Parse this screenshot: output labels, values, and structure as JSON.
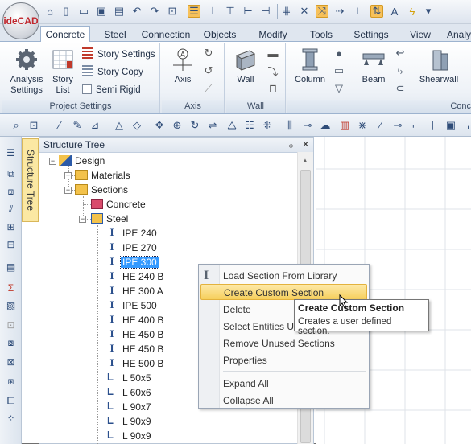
{
  "app": {
    "logo_text": "ideCAD"
  },
  "ribbon_tabs": [
    "Concrete",
    "Steel",
    "Connection",
    "Objects",
    "Modify",
    "Tools",
    "Settings",
    "View",
    "Analys"
  ],
  "project_settings": {
    "analysis_settings": "Analysis Settings",
    "story_list": "Story List",
    "story_settings": "Story Settings",
    "story_copy": "Story Copy",
    "semi_rigid": "Semi Rigid",
    "label": "Project Settings"
  },
  "axis_group": {
    "button": "Axis",
    "label": "Axis"
  },
  "wall_group": {
    "button": "Wall",
    "label": "Wall"
  },
  "conc_group": {
    "column": "Column",
    "beam": "Beam",
    "shearwall": "Shearwall",
    "label": "Conc"
  },
  "side_tab": "Structure Tree",
  "panel": {
    "title": "Structure Tree",
    "pin": "ᵩ",
    "close": "✕",
    "nodes": {
      "design": "Design",
      "materials": "Materials",
      "sections": "Sections",
      "concrete": "Concrete",
      "steel": "Steel",
      "items": [
        "IPE 240",
        "IPE 270",
        "IPE 300",
        "HE 240 B",
        "HE 300 A",
        "IPE 500",
        "HE 400 B",
        "HE 450 B",
        "HE 450 B",
        "HE 500 B",
        "L 50x5",
        "L 60x6",
        "L 90x7",
        "L 90x9",
        "L 90x9"
      ]
    }
  },
  "context_menu": {
    "load_section": "Load Section From Library",
    "create_custom": "Create Custom Section",
    "delete": "Delete",
    "select_entities": "Select Entities Us",
    "remove_unused": "Remove Unused Sections",
    "properties": "Properties",
    "expand_all": "Expand All",
    "collapse_all": "Collapse All"
  },
  "tooltip": {
    "title": "Create Custom Section",
    "body": "Creates a user defined section."
  },
  "colors": {
    "accent": "#f6cf5c",
    "selection": "#3399ff",
    "ribbon_bg": "#dfe6ef"
  }
}
